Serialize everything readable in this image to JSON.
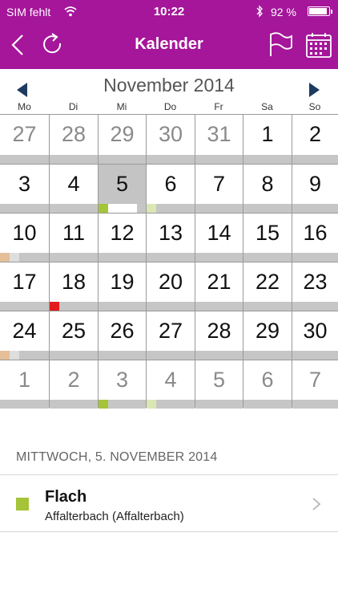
{
  "status": {
    "carrier": "SIM fehlt",
    "time": "10:22",
    "battery_text": "92 %",
    "battery_level": 0.92
  },
  "nav": {
    "title": "Kalender",
    "icons": [
      "back-chevron-icon",
      "reload-icon",
      "flag-icon",
      "calendar-grid-icon"
    ]
  },
  "colors": {
    "accent": "#a5169a",
    "green": "#a5c43a",
    "pale_green": "#dbe7b3",
    "tan": "#e4bf98",
    "light_gray": "#dedede",
    "red": "#e31b1b",
    "bar_gray": "#c6c6c6"
  },
  "month": {
    "title": "November 2014"
  },
  "weekdays": [
    "Mo",
    "Di",
    "Mi",
    "Do",
    "Fr",
    "Sa",
    "So"
  ],
  "weeks": [
    [
      {
        "d": "27",
        "m": true
      },
      {
        "d": "28",
        "m": true
      },
      {
        "d": "29",
        "m": true
      },
      {
        "d": "30",
        "m": true
      },
      {
        "d": "31",
        "m": true
      },
      {
        "d": "1"
      },
      {
        "d": "2"
      }
    ],
    [
      {
        "d": "3"
      },
      {
        "d": "4"
      },
      {
        "d": "5",
        "sel": true,
        "marks": [
          "green",
          "white",
          "white",
          "white"
        ]
      },
      {
        "d": "6",
        "marks": [
          "pale_green"
        ]
      },
      {
        "d": "7"
      },
      {
        "d": "8"
      },
      {
        "d": "9"
      }
    ],
    [
      {
        "d": "10",
        "marks": [
          "tan",
          "light_gray"
        ]
      },
      {
        "d": "11"
      },
      {
        "d": "12"
      },
      {
        "d": "13"
      },
      {
        "d": "14"
      },
      {
        "d": "15"
      },
      {
        "d": "16"
      }
    ],
    [
      {
        "d": "17"
      },
      {
        "d": "18",
        "marks": [
          "red"
        ]
      },
      {
        "d": "19"
      },
      {
        "d": "20"
      },
      {
        "d": "21"
      },
      {
        "d": "22"
      },
      {
        "d": "23"
      }
    ],
    [
      {
        "d": "24",
        "marks": [
          "tan",
          "light_gray"
        ]
      },
      {
        "d": "25"
      },
      {
        "d": "26"
      },
      {
        "d": "27"
      },
      {
        "d": "28"
      },
      {
        "d": "29"
      },
      {
        "d": "30"
      }
    ],
    [
      {
        "d": "1",
        "m": true
      },
      {
        "d": "2",
        "m": true
      },
      {
        "d": "3",
        "m": true,
        "marks": [
          "green"
        ]
      },
      {
        "d": "4",
        "m": true,
        "marks": [
          "pale_green"
        ]
      },
      {
        "d": "5",
        "m": true
      },
      {
        "d": "6",
        "m": true
      },
      {
        "d": "7",
        "m": true
      }
    ]
  ],
  "selected_day": {
    "heading": "MITTWOCH, 5. NOVEMBER 2014",
    "events": [
      {
        "title": "Flach",
        "subtitle": "Affalterbach (Affalterbach)",
        "color": "#a5c43a"
      }
    ]
  }
}
